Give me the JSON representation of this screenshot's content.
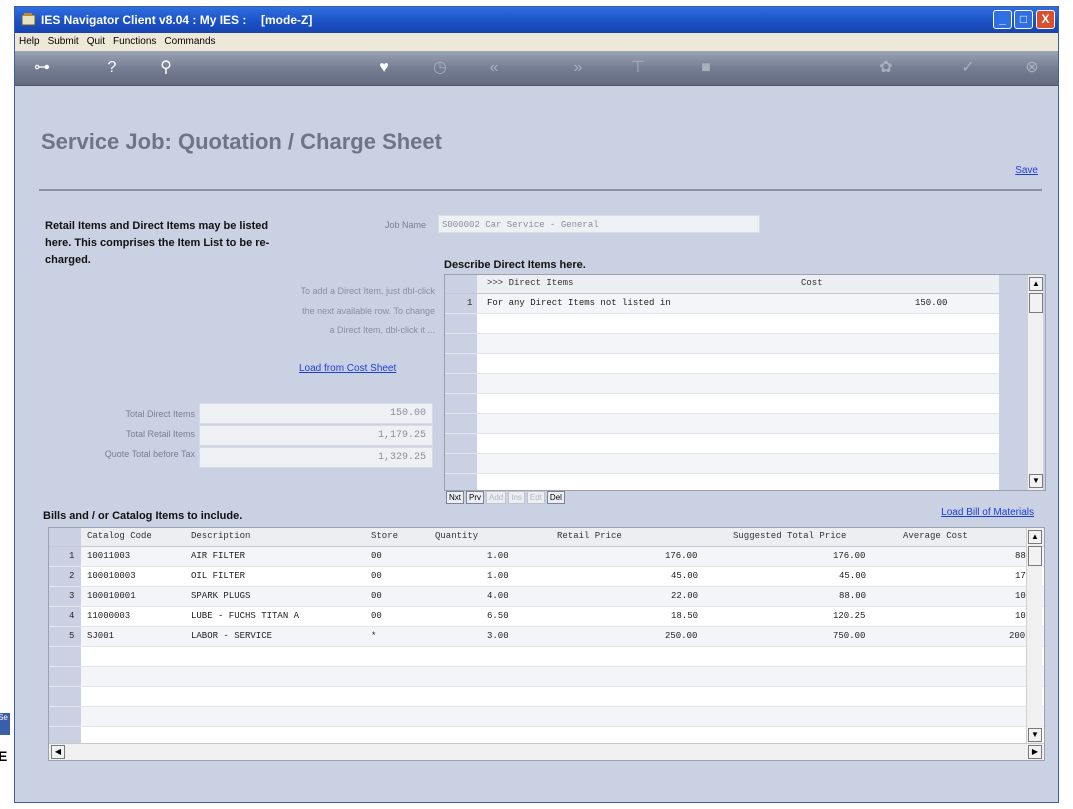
{
  "window": {
    "title": "IES Navigator Client v8.04 : My IES :",
    "mode": "[mode-Z]",
    "controls": [
      "_",
      "□",
      "X"
    ]
  },
  "menu": [
    "Help",
    "Submit",
    "Quit",
    "Functions",
    "Commands"
  ],
  "toolbar_icons": [
    "key-icon",
    "help-icon",
    "search-icon",
    "heart-icon",
    "clock-icon",
    "rewind-icon",
    "forward-icon",
    "tree-icon",
    "stop-icon",
    "gear-icon",
    "check-icon",
    "close-icon"
  ],
  "page": {
    "title": "Service Job: Quotation / Charge Sheet",
    "save_label": "Save",
    "intro": "Retail Items and Direct Items may be listed here. This comprises the Item List to be re-charged.",
    "job_name_label": "Job Name",
    "job_name_value": "S000002 Car Service - General",
    "direct_items_heading": "Describe Direct Items here.",
    "hint_lines": [
      "To add a Direct Item, just dbl-click",
      "the next available row. To change",
      "a Direct Item, dbl-click it ..."
    ],
    "load_cost_sheet": "Load from Cost Sheet",
    "totals": [
      {
        "label": "Total Direct Items",
        "value": "150.00"
      },
      {
        "label": "Total Retail Items",
        "value": "1,179.25"
      },
      {
        "label": "Quote Total before Tax",
        "value": "1,329.25"
      }
    ],
    "bills_heading": "Bills and / or Catalog Items to include.",
    "load_bom": "Load Bill of Materials"
  },
  "direct_grid": {
    "headers": {
      "desc": ">>> Direct Items",
      "cost": "Cost"
    },
    "rows": [
      {
        "num": "1",
        "desc": "For any Direct Items not listed in",
        "cost": "150.00"
      }
    ],
    "nav": [
      "Nxt",
      "Prv",
      "Add",
      "Ins",
      "Edt",
      "Del"
    ],
    "nav_enabled": [
      true,
      true,
      false,
      false,
      false,
      true
    ]
  },
  "items_grid": {
    "headers": [
      "Catalog Code",
      "Description",
      "Store",
      "Quantity",
      "Retail Price",
      "Suggested Total Price",
      "Average Cost"
    ],
    "rows": [
      {
        "num": "1",
        "code": "10011003",
        "desc": "AIR FILTER",
        "store": "00",
        "qty": "1.00",
        "price": "176.00",
        "total": "176.00",
        "avg": "88"
      },
      {
        "num": "2",
        "code": "100010003",
        "desc": "OIL FILTER",
        "store": "00",
        "qty": "1.00",
        "price": "45.00",
        "total": "45.00",
        "avg": "17"
      },
      {
        "num": "3",
        "code": "100010001",
        "desc": "SPARK PLUGS",
        "store": "00",
        "qty": "4.00",
        "price": "22.00",
        "total": "88.00",
        "avg": "10"
      },
      {
        "num": "4",
        "code": "11000003",
        "desc": "LUBE - FUCHS TITAN A",
        "store": "00",
        "qty": "6.50",
        "price": "18.50",
        "total": "120.25",
        "avg": "10"
      },
      {
        "num": "5",
        "code": "SJ001",
        "desc": "LABOR - SERVICE",
        "store": "*",
        "qty": "3.00",
        "price": "250.00",
        "total": "750.00",
        "avg": "200"
      }
    ]
  },
  "side_labels": {
    "chip": "Se",
    "letter": "E"
  }
}
